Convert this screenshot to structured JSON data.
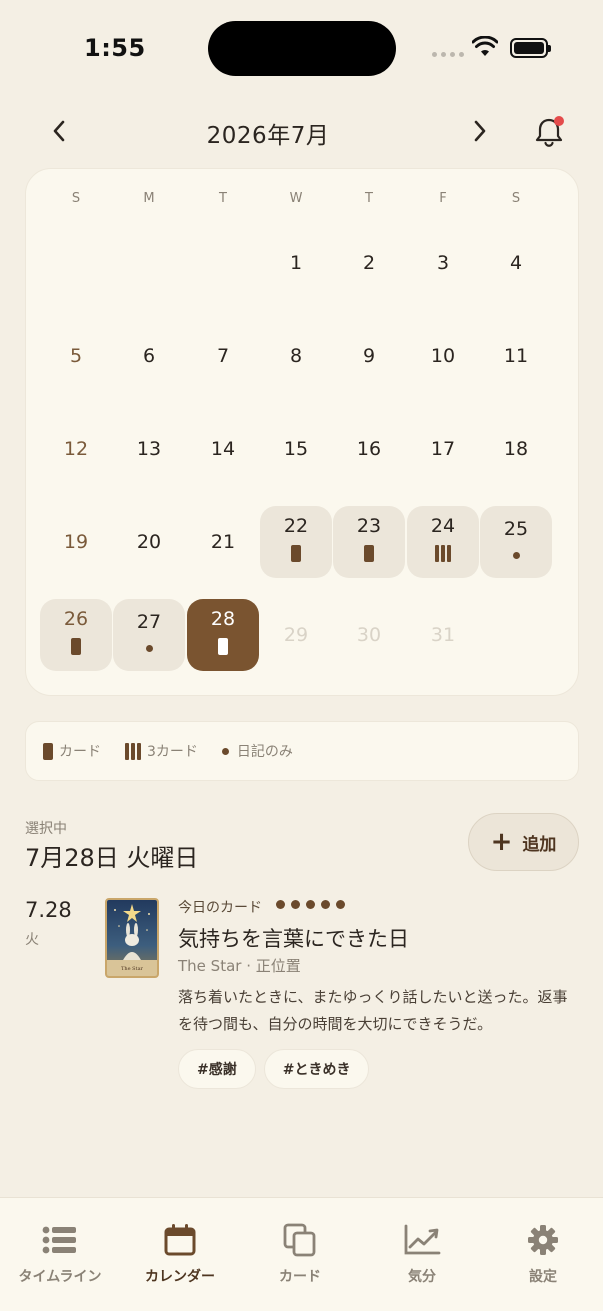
{
  "status_bar": {
    "time": "1:55"
  },
  "header": {
    "month_title": "2026年7月",
    "prev_icon": "chevron-left-icon",
    "next_icon": "chevron-right-icon",
    "notification_icon": "bell-icon",
    "has_notification": true
  },
  "calendar": {
    "weekdays": [
      "S",
      "M",
      "T",
      "W",
      "T",
      "F",
      "S"
    ],
    "weeks": [
      [
        {
          "day": ""
        },
        {
          "day": ""
        },
        {
          "day": ""
        },
        {
          "day": "1"
        },
        {
          "day": "2"
        },
        {
          "day": "3"
        },
        {
          "day": "4"
        }
      ],
      [
        {
          "day": "5",
          "sunday": true
        },
        {
          "day": "6"
        },
        {
          "day": "7"
        },
        {
          "day": "8"
        },
        {
          "day": "9"
        },
        {
          "day": "10"
        },
        {
          "day": "11"
        }
      ],
      [
        {
          "day": "12",
          "sunday": true
        },
        {
          "day": "13"
        },
        {
          "day": "14"
        },
        {
          "day": "15"
        },
        {
          "day": "16"
        },
        {
          "day": "17"
        },
        {
          "day": "18"
        }
      ],
      [
        {
          "day": "19",
          "sunday": true
        },
        {
          "day": "20"
        },
        {
          "day": "21"
        },
        {
          "day": "22",
          "mark": "card"
        },
        {
          "day": "23",
          "mark": "card"
        },
        {
          "day": "24",
          "mark": "three"
        },
        {
          "day": "25",
          "mark": "dot"
        }
      ],
      [
        {
          "day": "26",
          "sunday": true,
          "mark": "card"
        },
        {
          "day": "27",
          "mark": "dot"
        },
        {
          "day": "28",
          "mark": "card",
          "selected": true
        },
        {
          "day": "29",
          "future": true
        },
        {
          "day": "30",
          "future": true
        },
        {
          "day": "31",
          "future": true
        },
        {
          "day": ""
        }
      ]
    ]
  },
  "legend": {
    "card_label": "カード",
    "three_label": "3カード",
    "diary_label": "日記のみ"
  },
  "selected": {
    "label": "選択中",
    "date": "7月28日 火曜日",
    "add_label": "追加"
  },
  "entry": {
    "day": "7.28",
    "weekday": "火",
    "card_label": "今日のカード",
    "rating": 5,
    "title": "気持ちを言葉にできた日",
    "subtitle": "The Star · 正位置",
    "body": "落ち着いたときに、またゆっくり話したいと送った。返事を待つ間も、自分の時間を大切にできそうだ。",
    "tarot_caption": "The Star",
    "tags": [
      "#感謝",
      "#ときめき"
    ]
  },
  "tabs": [
    {
      "label": "タイムライン",
      "icon": "list-icon",
      "active": false
    },
    {
      "label": "カレンダー",
      "icon": "calendar-icon",
      "active": true
    },
    {
      "label": "カード",
      "icon": "cards-icon",
      "active": false
    },
    {
      "label": "気分",
      "icon": "chart-icon",
      "active": false
    },
    {
      "label": "設定",
      "icon": "gear-icon",
      "active": false
    }
  ],
  "colors": {
    "accent": "#7a5430",
    "background": "#f4efe4",
    "card": "#fbf8ee",
    "notification": "#e44b4b"
  }
}
